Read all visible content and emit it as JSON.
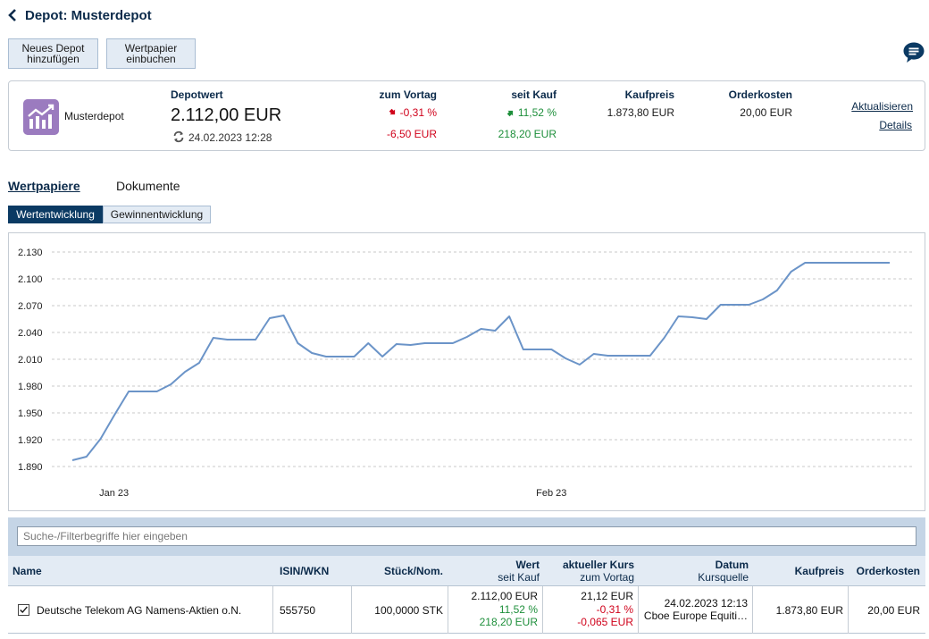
{
  "header": {
    "title": "Depot: Musterdepot",
    "back_icon": "chevron-left-icon",
    "chat_icon": "chat-icon"
  },
  "toolbar": {
    "new_depot_line1": "Neues Depot",
    "new_depot_line2": "hinzufügen",
    "book_line1": "Wertpapier",
    "book_line2": "einbuchen"
  },
  "summary": {
    "depot_name": "Musterdepot",
    "depotwert_label": "Depotwert",
    "depotwert": "2.112,00 EUR",
    "timestamp": "24.02.2023 12:28",
    "vortag_label": "zum Vortag",
    "vortag_pct": "-0,31 %",
    "vortag_abs": "-6,50 EUR",
    "kauf_label": "seit Kauf",
    "kauf_pct": "11,52 %",
    "kauf_abs": "218,20 EUR",
    "kaufpreis_label": "Kaufpreis",
    "kaufpreis": "1.873,80 EUR",
    "orderkosten_label": "Orderkosten",
    "orderkosten": "20,00 EUR",
    "link_refresh": "Aktualisieren",
    "link_details": "Details",
    "colors": {
      "negative": "#d0021b",
      "positive": "#1e8f3b",
      "logo": "#9b7bbf"
    }
  },
  "tabs": {
    "items": [
      {
        "label": "Wertpapiere",
        "active": true
      },
      {
        "label": "Dokumente",
        "active": false
      }
    ]
  },
  "subtabs": {
    "items": [
      {
        "label": "Wertentwicklung",
        "active": true
      },
      {
        "label": "Gewinnentwicklung",
        "active": false
      }
    ]
  },
  "chart_data": {
    "type": "line",
    "title": "",
    "xlabel": "",
    "ylabel": "",
    "ylim": [
      1880,
      2140
    ],
    "yticks": [
      1890,
      1920,
      1950,
      1980,
      2010,
      2040,
      2070,
      2100,
      2130
    ],
    "ytick_labels": [
      "1.890",
      "1.920",
      "1.950",
      "1.980",
      "2.010",
      "2.040",
      "2.070",
      "2.100",
      "2.130"
    ],
    "xticks": [
      {
        "label": "Jan 23",
        "date": "2023-01-01"
      },
      {
        "label": "Feb 23",
        "date": "2023-02-01"
      }
    ],
    "grid": true,
    "color": "#6b94c8",
    "x": [
      "2022-12-28",
      "2022-12-29",
      "2022-12-30",
      "2022-12-31",
      "2023-01-01",
      "2023-01-02",
      "2023-01-03",
      "2023-01-04",
      "2023-01-05",
      "2023-01-06",
      "2023-01-07",
      "2023-01-08",
      "2023-01-09",
      "2023-01-10",
      "2023-01-11",
      "2023-01-12",
      "2023-01-13",
      "2023-01-14",
      "2023-01-15",
      "2023-01-16",
      "2023-01-17",
      "2023-01-18",
      "2023-01-19",
      "2023-01-20",
      "2023-01-21",
      "2023-01-22",
      "2023-01-23",
      "2023-01-24",
      "2023-01-25",
      "2023-01-26",
      "2023-01-27",
      "2023-01-28",
      "2023-01-29",
      "2023-01-30",
      "2023-01-31",
      "2023-02-01",
      "2023-02-02",
      "2023-02-03",
      "2023-02-04",
      "2023-02-05",
      "2023-02-06",
      "2023-02-07",
      "2023-02-08",
      "2023-02-09",
      "2023-02-10",
      "2023-02-11",
      "2023-02-12",
      "2023-02-13",
      "2023-02-14",
      "2023-02-15",
      "2023-02-16",
      "2023-02-17",
      "2023-02-18",
      "2023-02-19",
      "2023-02-20",
      "2023-02-21",
      "2023-02-22",
      "2023-02-23",
      "2023-02-24"
    ],
    "values": [
      1897,
      1901,
      1921,
      1948,
      1974,
      1974,
      1974,
      1982,
      1996,
      2006,
      2034,
      2032,
      2032,
      2032,
      2056,
      2059,
      2028,
      2017,
      2013,
      2013,
      2013,
      2028,
      2013,
      2027,
      2026,
      2028,
      2028,
      2028,
      2035,
      2044,
      2042,
      2058,
      2021,
      2021,
      2021,
      2011,
      2004,
      2016,
      2014,
      2014,
      2014,
      2014,
      2034,
      2058,
      2057,
      2055,
      2071,
      2071,
      2071,
      2077,
      2087,
      2108,
      2118,
      2118,
      2118,
      2118,
      2118,
      2118,
      2118
    ]
  },
  "filter": {
    "placeholder": "Suche-/Filterbegriffe hier eingeben"
  },
  "table": {
    "headers": {
      "name": "Name",
      "isin": "ISIN/WKN",
      "stueck": "Stück/Nom.",
      "wert": "Wert",
      "wert_sub": "seit Kauf",
      "kurs": "aktueller Kurs",
      "kurs_sub": "zum Vortag",
      "datum": "Datum",
      "datum_sub": "Kursquelle",
      "kaufpreis": "Kaufpreis",
      "orderkosten": "Orderkosten"
    },
    "rows": [
      {
        "checked": true,
        "name": "Deutsche Telekom AG Namens-Aktien o.N.",
        "isin": "555750",
        "stueck": "100,0000 STK",
        "wert": "2.112,00 EUR",
        "wert_pct": "11,52 %",
        "wert_abs": "218,20 EUR",
        "kurs": "21,12 EUR",
        "kurs_pct": "-0,31 %",
        "kurs_abs": "-0,065 EUR",
        "datum": "24.02.2023 12:13",
        "quelle": "Cboe Europe Equiti…",
        "kaufpreis": "1.873,80 EUR",
        "orderkosten": "20,00 EUR"
      }
    ]
  }
}
